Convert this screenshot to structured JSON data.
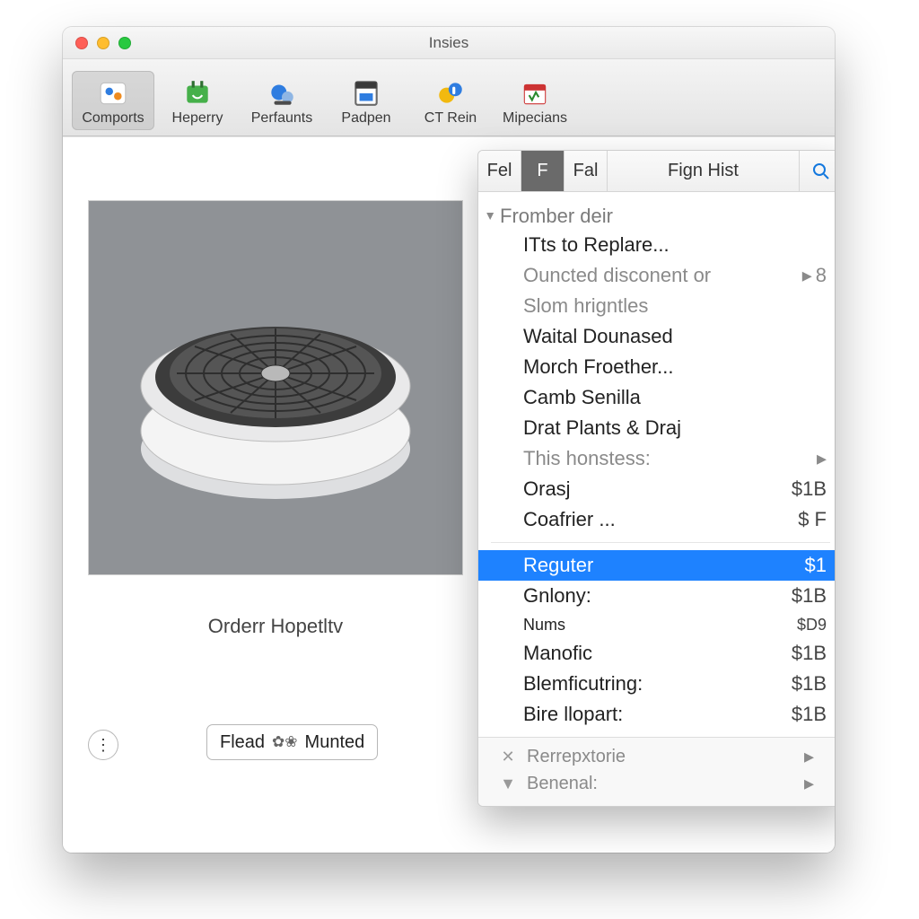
{
  "window": {
    "title": "Insies"
  },
  "toolbar": {
    "items": [
      {
        "label": "Comports",
        "selected": true
      },
      {
        "label": "Heperry"
      },
      {
        "label": "Perfaunts"
      },
      {
        "label": "Padpen"
      },
      {
        "label": "CT Rein"
      },
      {
        "label": "Mipecians"
      }
    ]
  },
  "preview": {
    "caption": "Orderr Hopetltv"
  },
  "bottomBar": {
    "seg1": "Flead",
    "seg2": "Munted"
  },
  "panel": {
    "tabs": {
      "t1": "Fel",
      "t2": "F",
      "t3": "Fal",
      "t4": "Fign Hist"
    },
    "section1_title": "Fromber deir",
    "section1_sub_title": "This honstess:",
    "rows": [
      {
        "label": "ITts to Replare...",
        "trail": ""
      },
      {
        "label": "Ouncted disconent or",
        "trail": "▶ 8",
        "dim": true
      },
      {
        "label": "Slom hrigntles",
        "trail": "",
        "dim": true
      },
      {
        "label": "Waital Dounased",
        "trail": ""
      },
      {
        "label": "Morch Froether...",
        "trail": ""
      },
      {
        "label": "Camb Senilla",
        "trail": ""
      },
      {
        "label": "Drat Plants & Draj",
        "trail": ""
      }
    ],
    "rows2": [
      {
        "label": "Orasj",
        "trail": "$1B"
      },
      {
        "label": "Coafrier ...",
        "trail": "$ F"
      }
    ],
    "highlight": {
      "label": "Reguter",
      "trail": "$1"
    },
    "rows3": [
      {
        "label": "Gnlony:",
        "trail": "$1B"
      },
      {
        "label": "Nums",
        "trail": "$D9",
        "small": true
      },
      {
        "label": "Manofic",
        "trail": "$1B"
      },
      {
        "label": "Blemficutring:",
        "trail": "$1B"
      },
      {
        "label": "Bire llopart:",
        "trail": "$1B"
      }
    ],
    "footer": {
      "r1": "Rerrepxtorie",
      "r2": "Benenal:"
    }
  }
}
